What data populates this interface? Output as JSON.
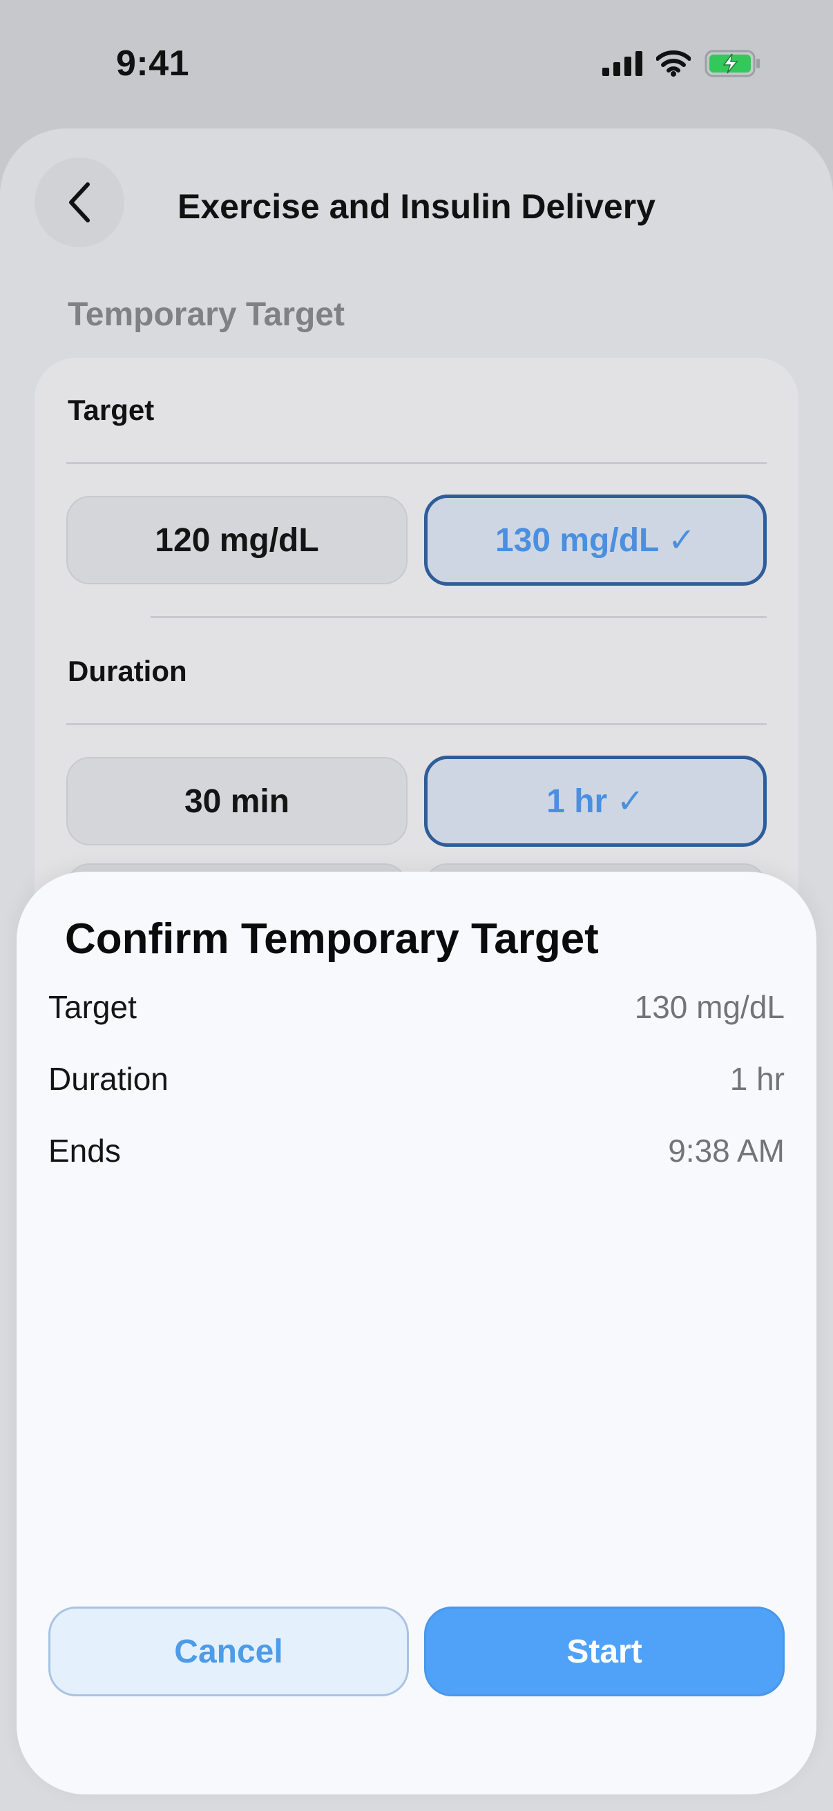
{
  "status_bar": {
    "time": "9:41",
    "icons": [
      "signal-icon",
      "wifi-icon",
      "battery-charging-icon"
    ],
    "battery_color": "#34c759"
  },
  "nav": {
    "title": "Exercise and Insulin Delivery",
    "back_icon": "chevron-left-icon"
  },
  "section": {
    "label": "Temporary Target"
  },
  "target_row": {
    "title": "Target",
    "options": [
      {
        "label": "120 mg/dL",
        "selected": false
      },
      {
        "label": "130 mg/dL ✓",
        "selected": true
      }
    ]
  },
  "duration_row": {
    "title": "Duration",
    "options": [
      {
        "label": "30 min",
        "selected": false
      },
      {
        "label": "1 hr ✓",
        "selected": true
      }
    ]
  },
  "confirm_sheet": {
    "title": "Confirm Temporary Target",
    "rows": [
      {
        "label": "Target",
        "value": "130 mg/dL"
      },
      {
        "label": "Duration",
        "value": "1 hr"
      },
      {
        "label": "Ends",
        "value": "9:38 AM"
      }
    ],
    "cancel_label": "Cancel",
    "start_label": "Start"
  },
  "colors": {
    "accent": "#50a2f8",
    "selected_border": "#2f5d98",
    "selected_text": "#4a8fe0"
  }
}
